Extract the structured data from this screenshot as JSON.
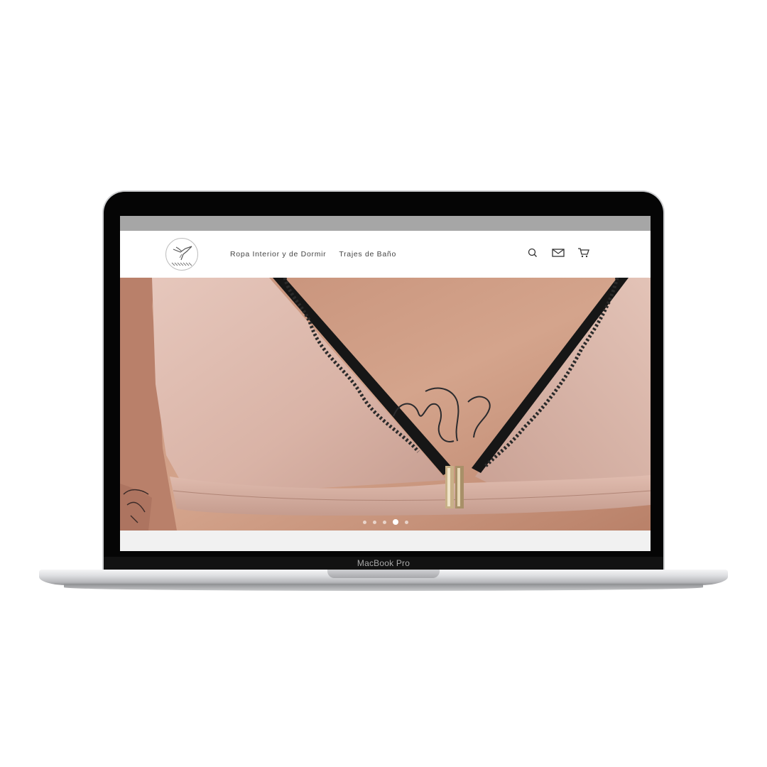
{
  "device": {
    "model_label": "MacBook Pro"
  },
  "site": {
    "nav": {
      "items": [
        {
          "label": "Ropa Interior y de Dormir"
        },
        {
          "label": "Trajes de Baño"
        }
      ]
    },
    "header_icons": [
      "search-icon",
      "mail-icon",
      "cart-icon"
    ],
    "hero": {
      "slides_total": 5,
      "active_slide": 4
    },
    "colors": {
      "accent_strip": "#a6a6a6",
      "nav_text": "#444444",
      "fabric_pink": "#dcb7aa",
      "lace_black": "#141414"
    }
  }
}
